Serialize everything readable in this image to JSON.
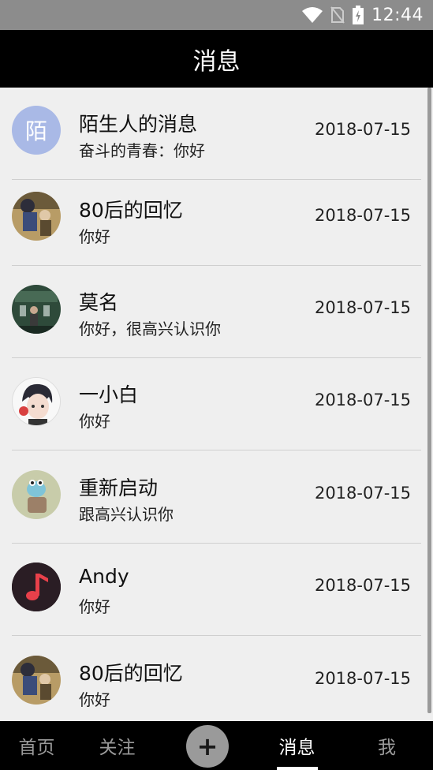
{
  "status_bar": {
    "time": "12:44"
  },
  "header": {
    "title": "消息"
  },
  "messages": [
    {
      "name": "陌生人的消息",
      "message": "奋斗的青春：你好",
      "date": "2018-07-15",
      "avatar": "stranger-avatar",
      "avatar_text": "陌"
    },
    {
      "name": "80后的回忆",
      "message": "你好",
      "date": "2018-07-15",
      "avatar": "photo-avatar"
    },
    {
      "name": "莫名",
      "message": "你好，很高兴认识你",
      "date": "2018-07-15",
      "avatar": "photo-avatar"
    },
    {
      "name": "一小白",
      "message": "你好",
      "date": "2018-07-15",
      "avatar": "anime-avatar"
    },
    {
      "name": "重新启动",
      "message": "跟高兴认识你",
      "date": "2018-07-15",
      "avatar": "cartoon-avatar"
    },
    {
      "name": "Andy",
      "message": "你好",
      "date": "2018-07-15",
      "avatar": "music-note-avatar"
    },
    {
      "name": "80后的回忆",
      "message": "你好",
      "date": "2018-07-15",
      "avatar": "photo-avatar"
    }
  ],
  "tabs": {
    "home": "首页",
    "follow": "关注",
    "add": "+",
    "messages": "消息",
    "me": "我"
  },
  "colors": {
    "title_bar": "#000000",
    "status_bar": "#8c8c8c",
    "list_bg": "#efefef",
    "stranger_avatar": "#a9b9e6",
    "tab_active": "#ffffff",
    "tab_inactive": "#9a9a9a"
  }
}
